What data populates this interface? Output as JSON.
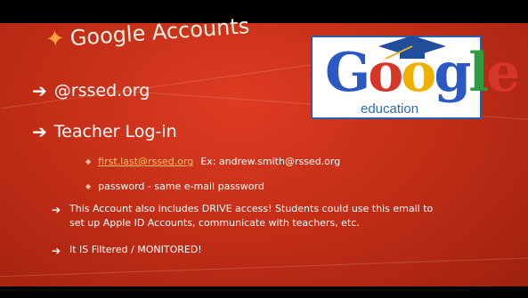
{
  "title": "Google Accounts",
  "logo": {
    "word": "Google",
    "sub": "education"
  },
  "bullets": {
    "domain": "@rssed.org",
    "teacher_login": "Teacher Log-in",
    "sub1_link": "first.last@rssed.org",
    "sub1_rest": "Ex: andrew.smith@rssed.org",
    "sub2": "password - same e-mail password",
    "note1_line1": "This Account also includes DRIVE access! Students could use this email to",
    "note1_line2": "set up Apple ID Accounts, communicate with teachers, etc.",
    "note2": "It IS Filtered / MONITORED!"
  },
  "colors": {
    "background": "#c42e17",
    "title": "#f3f0e4",
    "star": "#f7a13a",
    "link": "#f7c86a"
  }
}
